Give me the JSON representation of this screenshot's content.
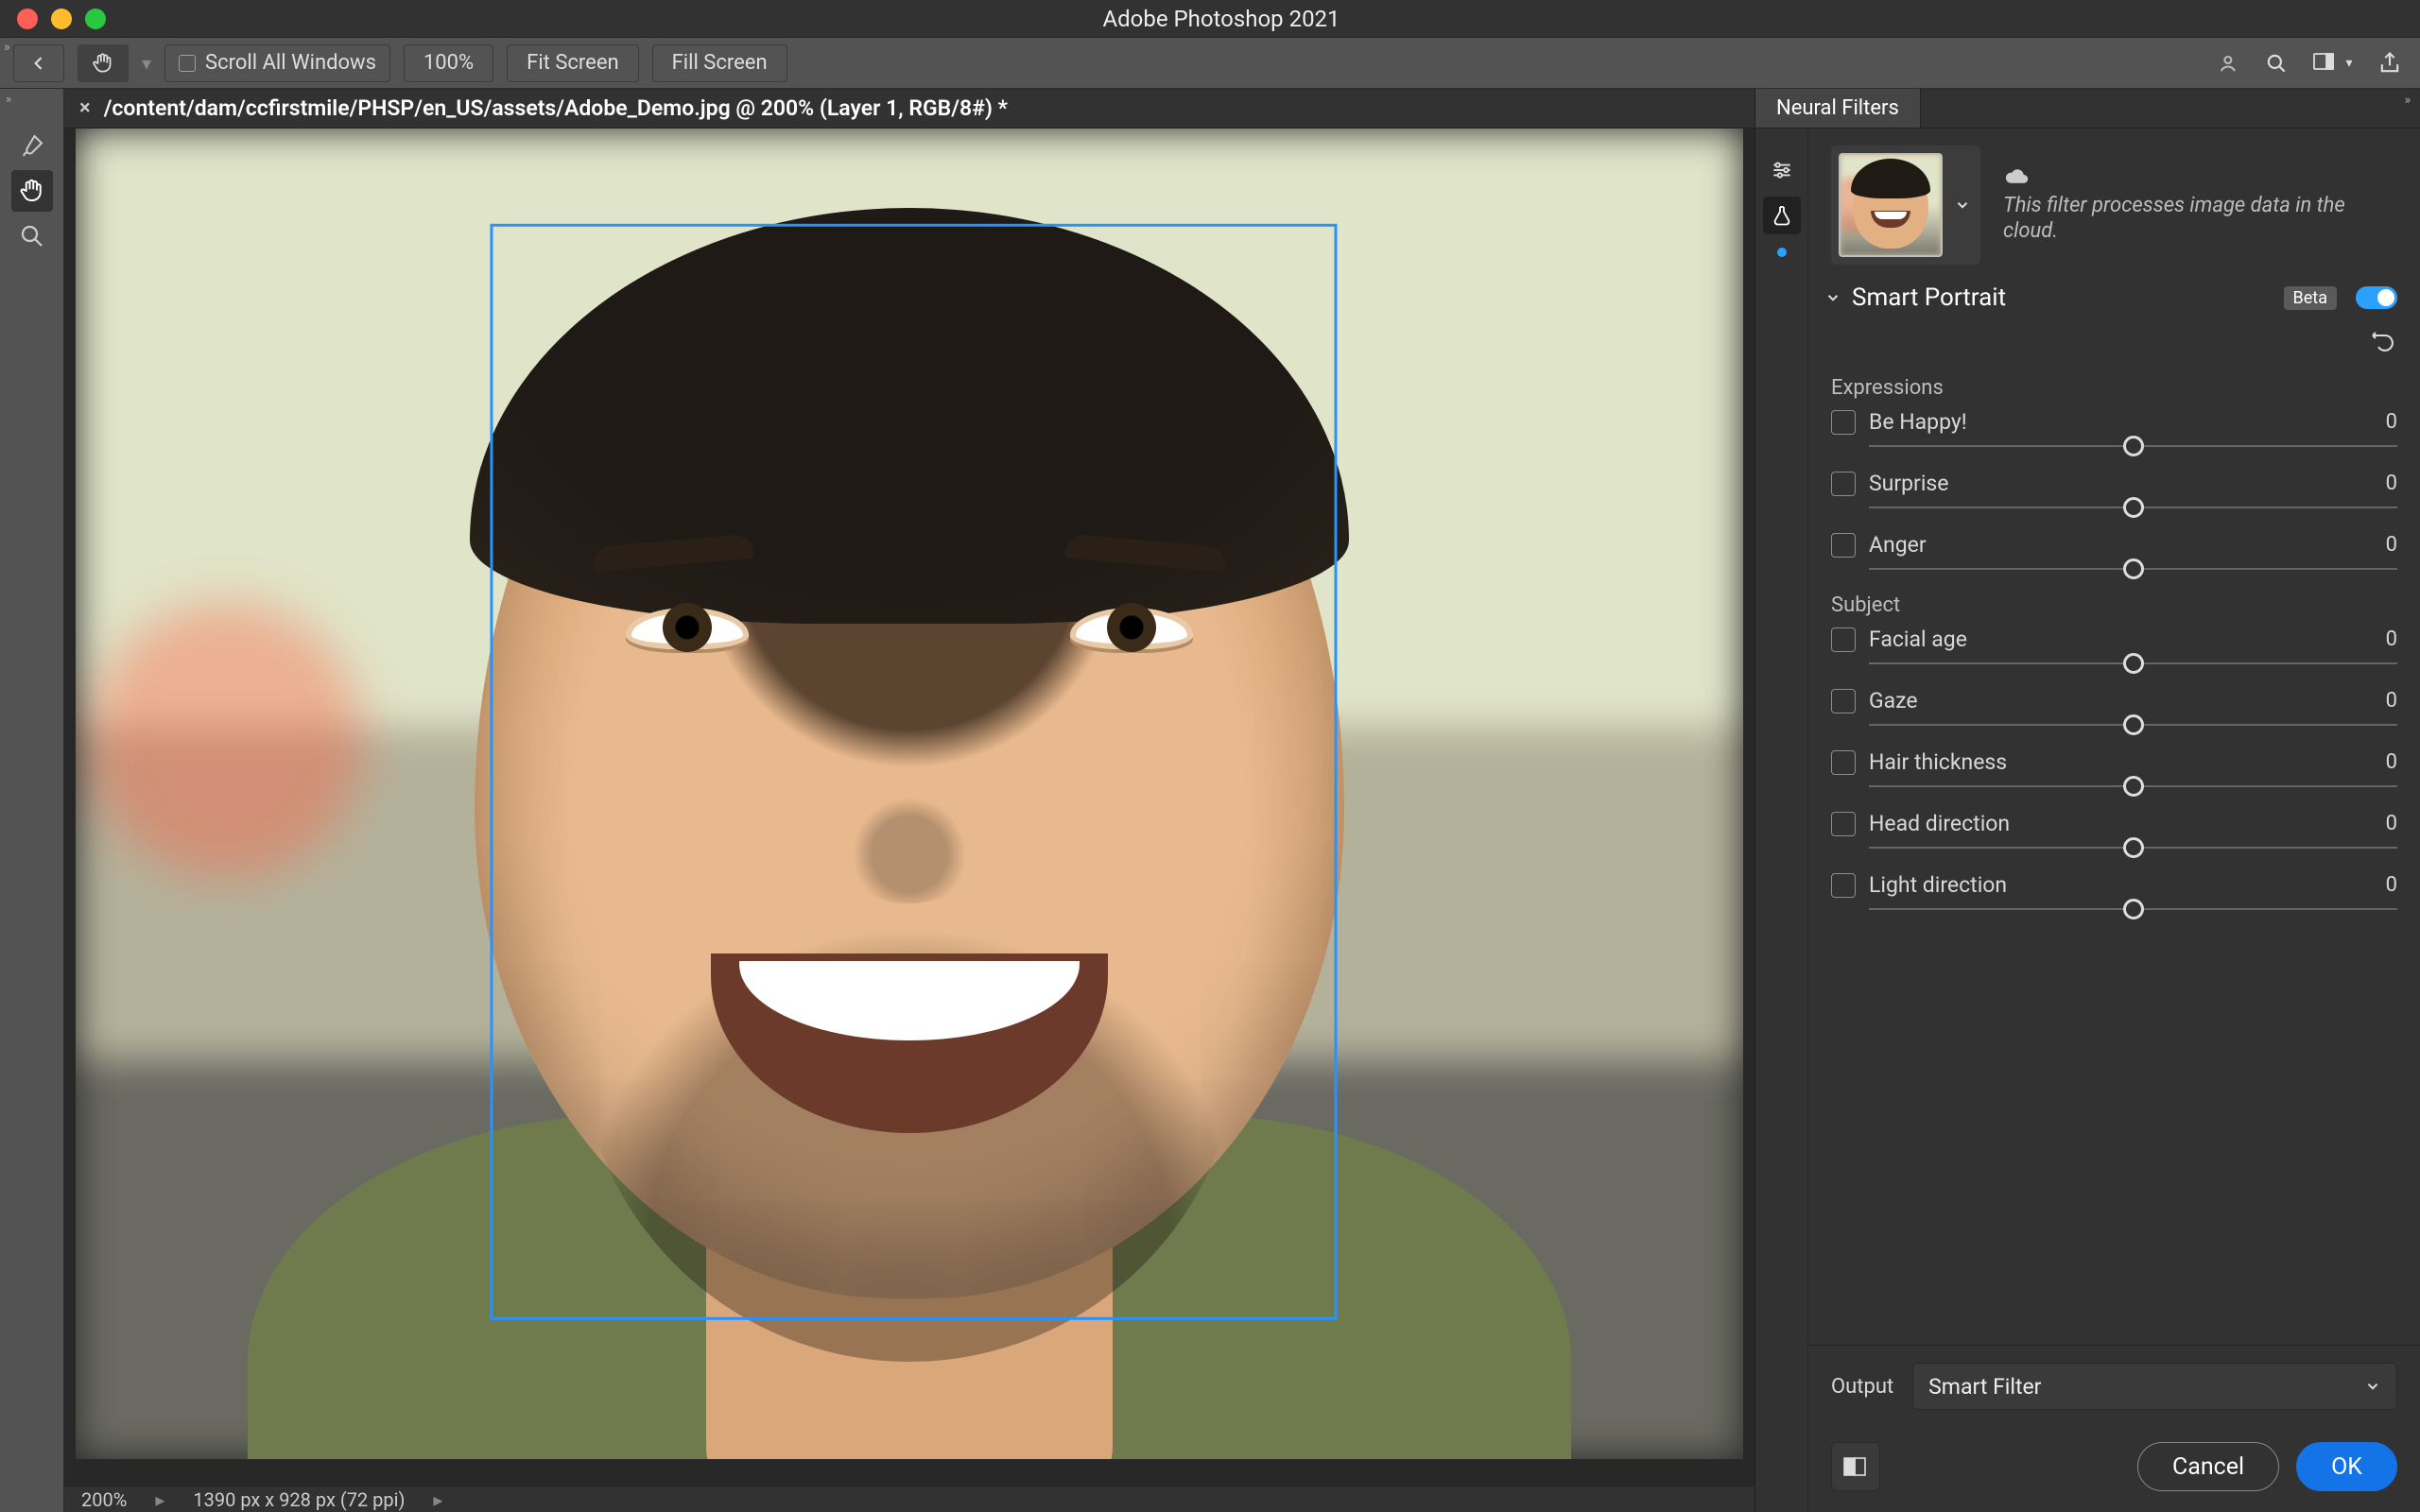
{
  "title": "Adobe Photoshop 2021",
  "options": {
    "scroll_all_label": "Scroll All Windows",
    "zoom_pct": "100%",
    "fit_screen": "Fit Screen",
    "fill_screen": "Fill Screen"
  },
  "document": {
    "tab_title": "/content/dam/ccfirstmile/PHSP/en_US/assets/Adobe_Demo.jpg @ 200% (Layer 1, RGB/8#) *"
  },
  "status": {
    "zoom": "200%",
    "dimensions": "1390 px x 928 px (72 ppi)"
  },
  "panel": {
    "tab": "Neural Filters",
    "cloud_note": "This filter processes image data in the cloud.",
    "filter_name": "Smart Portrait",
    "beta_label": "Beta",
    "groups": [
      {
        "title": "Expressions",
        "items": [
          {
            "label": "Be Happy!",
            "value": "0"
          },
          {
            "label": "Surprise",
            "value": "0"
          },
          {
            "label": "Anger",
            "value": "0"
          }
        ]
      },
      {
        "title": "Subject",
        "items": [
          {
            "label": "Facial age",
            "value": "0"
          },
          {
            "label": "Gaze",
            "value": "0"
          },
          {
            "label": "Hair thickness",
            "value": "0"
          },
          {
            "label": "Head direction",
            "value": "0"
          },
          {
            "label": "Light direction",
            "value": "0"
          }
        ]
      }
    ],
    "output_label": "Output",
    "output_value": "Smart Filter",
    "cancel": "Cancel",
    "ok": "OK"
  }
}
